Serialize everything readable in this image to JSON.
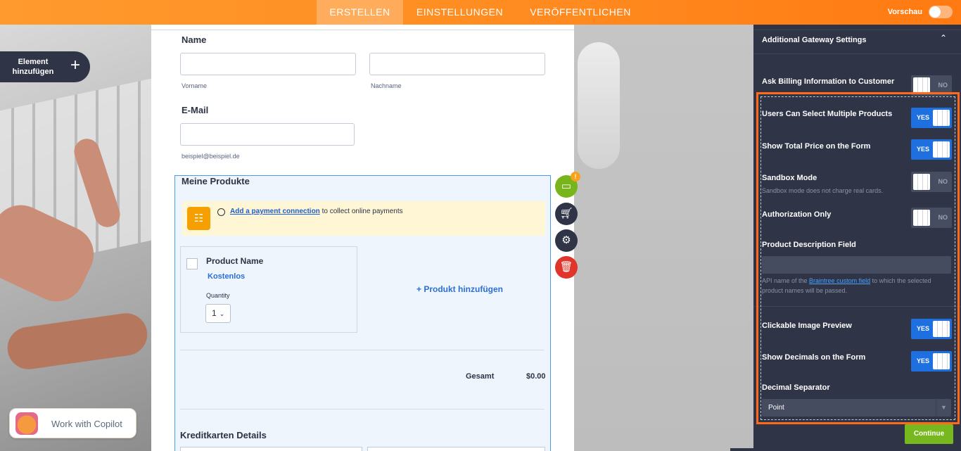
{
  "topbar": {
    "tabs": [
      {
        "label": "ERSTELLEN",
        "active": true
      },
      {
        "label": "EINSTELLUNGEN",
        "active": false
      },
      {
        "label": "VERÖFFENTLICHEN",
        "active": false
      }
    ],
    "preview_label": "Vorschau",
    "preview_on": false
  },
  "left_tools": {
    "add_element_label": "Element hinzufügen",
    "add_element_icon": "plus-icon",
    "copilot_label": "Work with Copilot"
  },
  "form": {
    "name_label": "Name",
    "first_name_sub": "Vorname",
    "last_name_sub": "Nachname",
    "email_label": "E-Mail",
    "email_sub": "beispiel@beispiel.de",
    "products_title": "Meine Produkte",
    "banner": {
      "link_text": "Add a payment connection",
      "rest_text": " to collect online payments"
    },
    "product": {
      "name": "Product Name",
      "price": "Kostenlos",
      "quantity_label": "Quantity",
      "quantity_value": "1"
    },
    "add_product_label": "+ Produkt hinzufügen",
    "total_label": "Gesamt",
    "total_value": "$0.00",
    "credit_card_title": "Kreditkarten Details"
  },
  "tool_icons": [
    {
      "name": "payment-icon",
      "color": "#78b41b",
      "badge": "!"
    },
    {
      "name": "cart-icon",
      "color": "#2f3447"
    },
    {
      "name": "gear-icon",
      "color": "#2f3447"
    },
    {
      "name": "trash-icon",
      "color": "#e0352b"
    }
  ],
  "panel": {
    "title": "Additional Gateway Settings",
    "settings": [
      {
        "label": "Ask Billing Information to Customer",
        "on": false,
        "text": "NO"
      },
      {
        "label": "Users Can Select Multiple Products",
        "on": true,
        "text": "YES"
      },
      {
        "label": "Show Total Price on the Form",
        "on": true,
        "text": "YES"
      },
      {
        "label": "Sandbox Mode",
        "on": false,
        "text": "NO",
        "desc": "Sandbox mode does not charge real cards."
      },
      {
        "label": "Authorization Only",
        "on": false,
        "text": "NO"
      },
      {
        "label": "Clickable Image Preview",
        "on": true,
        "text": "YES"
      },
      {
        "label": "Show Decimals on the Form",
        "on": true,
        "text": "YES"
      }
    ],
    "product_desc_label": "Product Description Field",
    "product_desc_value": "",
    "product_desc_help_pre": "API name of the ",
    "product_desc_help_link": "Braintree custom field",
    "product_desc_help_post": " to which the selected product names will be passed.",
    "decimal_label": "Decimal Separator",
    "decimal_value": "Point",
    "continue_label": "Continue",
    "colors": {
      "accent_on": "#1e70e0",
      "highlight": "#ff6a1a",
      "continue": "#77b81e"
    }
  }
}
